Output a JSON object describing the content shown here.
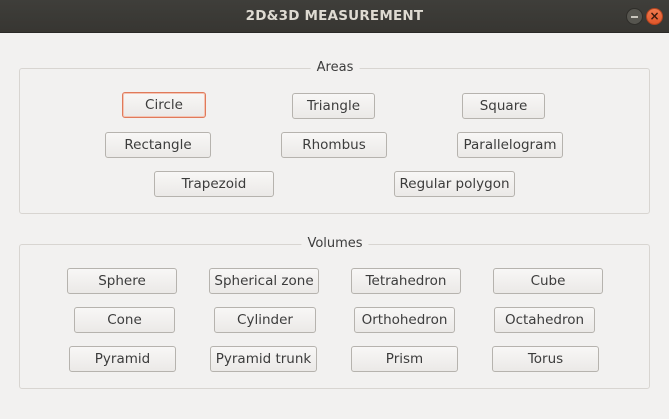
{
  "window": {
    "title": "2D&3D MEASUREMENT",
    "minimize_glyph": "",
    "close_glyph": "×"
  },
  "areas": {
    "label": "Areas",
    "buttons": {
      "circle": "Circle",
      "triangle": "Triangle",
      "square": "Square",
      "rectangle": "Rectangle",
      "rhombus": "Rhombus",
      "parallelogram": "Parallelogram",
      "trapezoid": "Trapezoid",
      "regular_polygon": "Regular polygon"
    },
    "focused": "circle"
  },
  "volumes": {
    "label": "Volumes",
    "buttons": {
      "sphere": "Sphere",
      "spherical_zone": "Spherical zone",
      "tetrahedron": "Tetrahedron",
      "cube": "Cube",
      "cone": "Cone",
      "cylinder": "Cylinder",
      "orthohedron": "Orthohedron",
      "octahedron": "Octahedron",
      "pyramid": "Pyramid",
      "pyramid_trunk": "Pyramid trunk",
      "prism": "Prism",
      "torus": "Torus"
    }
  },
  "colors": {
    "titlebar": "#3c3b37",
    "window_bg": "#f2f1f0",
    "focus_accent": "#e07a5a",
    "close_button": "#e9642f"
  },
  "icons": {
    "minimize": "minimize-icon",
    "close": "close-icon"
  }
}
